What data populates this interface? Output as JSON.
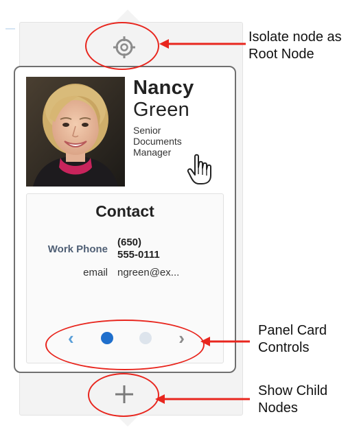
{
  "card": {
    "first_name": "Nancy",
    "last_name": "Green",
    "title_lines": [
      "Senior",
      "Documents",
      "Manager"
    ],
    "panel": {
      "title": "Contact",
      "work_phone_label": "Work Phone",
      "work_phone_lines": [
        "(650)",
        "555-0111"
      ],
      "email_label": "email",
      "email_value": "ngreen@ex..."
    },
    "controls": {
      "prev_glyph": "‹",
      "next_glyph": "›",
      "active_page": 1,
      "page_count": 2
    },
    "isolate_icon": "target-crosshair-icon",
    "show_children_icon": "plus-icon"
  },
  "annotations": {
    "isolate": [
      "Isolate node as",
      "Root Node"
    ],
    "panel_controls": [
      "Panel Card",
      "Controls"
    ],
    "show_children": [
      "Show Child",
      "Nodes"
    ]
  },
  "colors": {
    "annotation_red": "#e8261e",
    "active_dot": "#1f6fcc",
    "inactive_dot": "#dde4ec",
    "card_border": "#6f6f6f",
    "frame_bg": "#f3f3f3",
    "label_blue_gray": "#4f5f75"
  }
}
